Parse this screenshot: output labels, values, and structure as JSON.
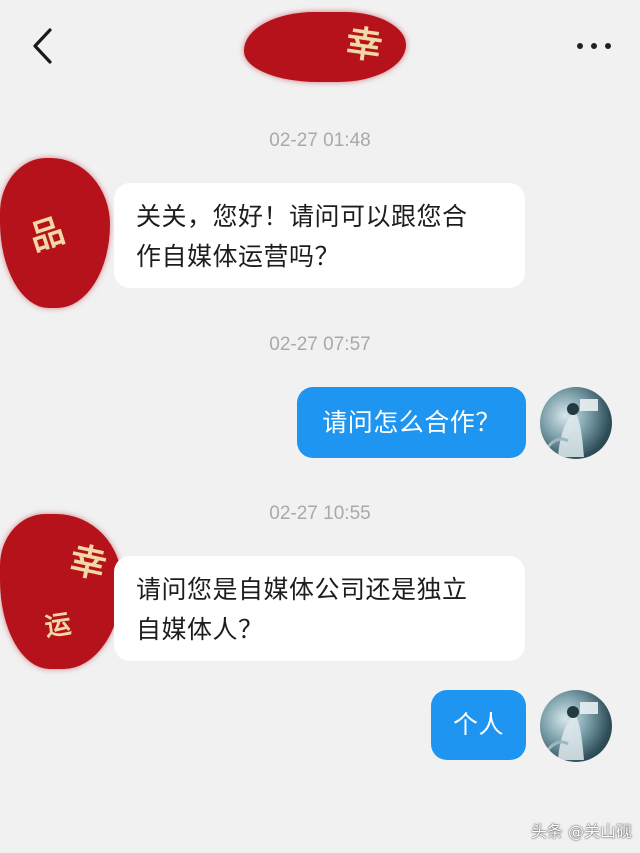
{
  "header": {
    "title_char": "幸",
    "back_icon": "chevron-left-icon",
    "more_icon": "more-dots-icon"
  },
  "messages": [
    {
      "timestamp": "02-27 01:48",
      "side": "incoming",
      "lines": [
        "关关，您好！请问可以跟您合",
        "作自媒体运营吗？"
      ]
    },
    {
      "timestamp": "02-27 07:57",
      "side": "outgoing",
      "text": "请问怎么合作？"
    },
    {
      "timestamp": "02-27 10:55",
      "side": "incoming",
      "lines": [
        "请问您是自媒体公司还是独立",
        "自媒体人？"
      ]
    },
    {
      "side": "outgoing",
      "text": "个人"
    }
  ],
  "avatars": {
    "left1_glyph": "品",
    "left2_glyph_top": "幸",
    "left2_glyph_bottom": "运"
  },
  "watermark": "头条 @关山砚",
  "colors": {
    "background": "#f1f1f1",
    "outgoing_bubble": "#1f95f2",
    "incoming_bubble": "#ffffff",
    "redaction": "#b5121b",
    "timestamp": "#a9a9a9"
  }
}
